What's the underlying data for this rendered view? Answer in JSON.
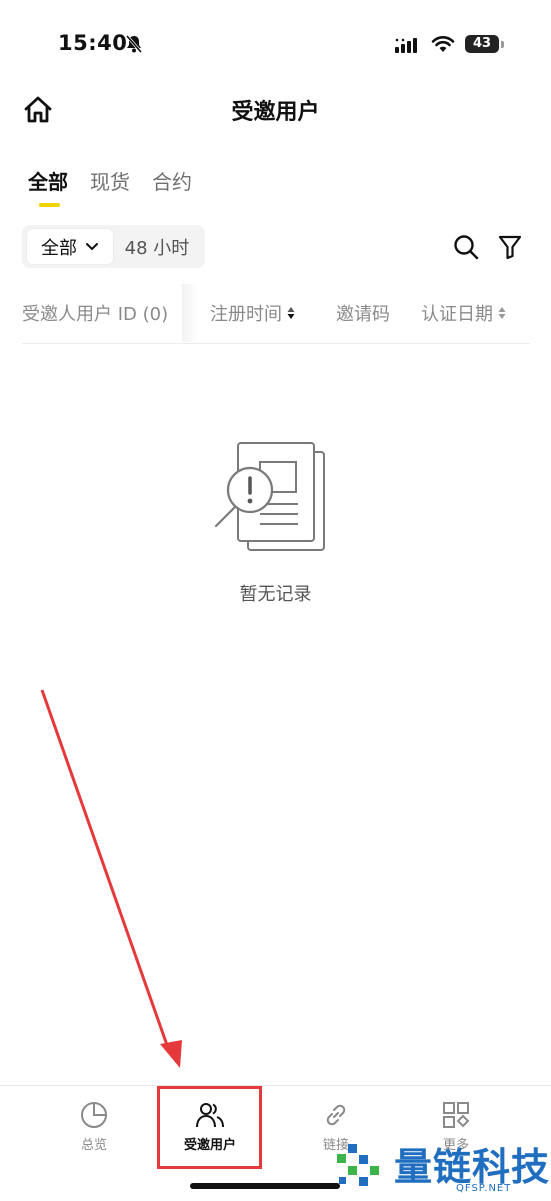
{
  "status_bar": {
    "time": "15:40",
    "battery": "43",
    "icons": [
      "bell-slash-icon",
      "signal-icon",
      "wifi-icon",
      "battery-icon"
    ]
  },
  "header": {
    "title": "受邀用户",
    "home_icon": "home-icon"
  },
  "tabs": [
    {
      "label": "全部",
      "active": true
    },
    {
      "label": "现货",
      "active": false
    },
    {
      "label": "合约",
      "active": false
    }
  ],
  "filters": {
    "scope_selected": "全部",
    "time_range": "48 小时",
    "icons": [
      "search-icon",
      "filter-icon"
    ]
  },
  "table": {
    "columns": [
      {
        "label": "受邀人用户 ID (0)",
        "sortable": false
      },
      {
        "label": "注册时间",
        "sortable": true
      },
      {
        "label": "邀请码",
        "sortable": false
      },
      {
        "label": "认证日期",
        "sortable": true
      }
    ],
    "rows": []
  },
  "empty_state": {
    "text": "暂无记录",
    "icon": "empty-document-icon"
  },
  "bottom_nav": [
    {
      "label": "总览",
      "icon": "pie-chart-icon",
      "active": false
    },
    {
      "label": "受邀用户",
      "icon": "users-icon",
      "active": true
    },
    {
      "label": "链接",
      "icon": "link-icon",
      "active": false
    },
    {
      "label": "更多",
      "icon": "grid-icon",
      "active": false
    }
  ],
  "colors": {
    "accent": "#f0d400",
    "annotation": "#e6393b",
    "watermark": "#1f6ec0"
  },
  "watermark": {
    "text": "量链科技",
    "sub": "QFSP.NET"
  }
}
